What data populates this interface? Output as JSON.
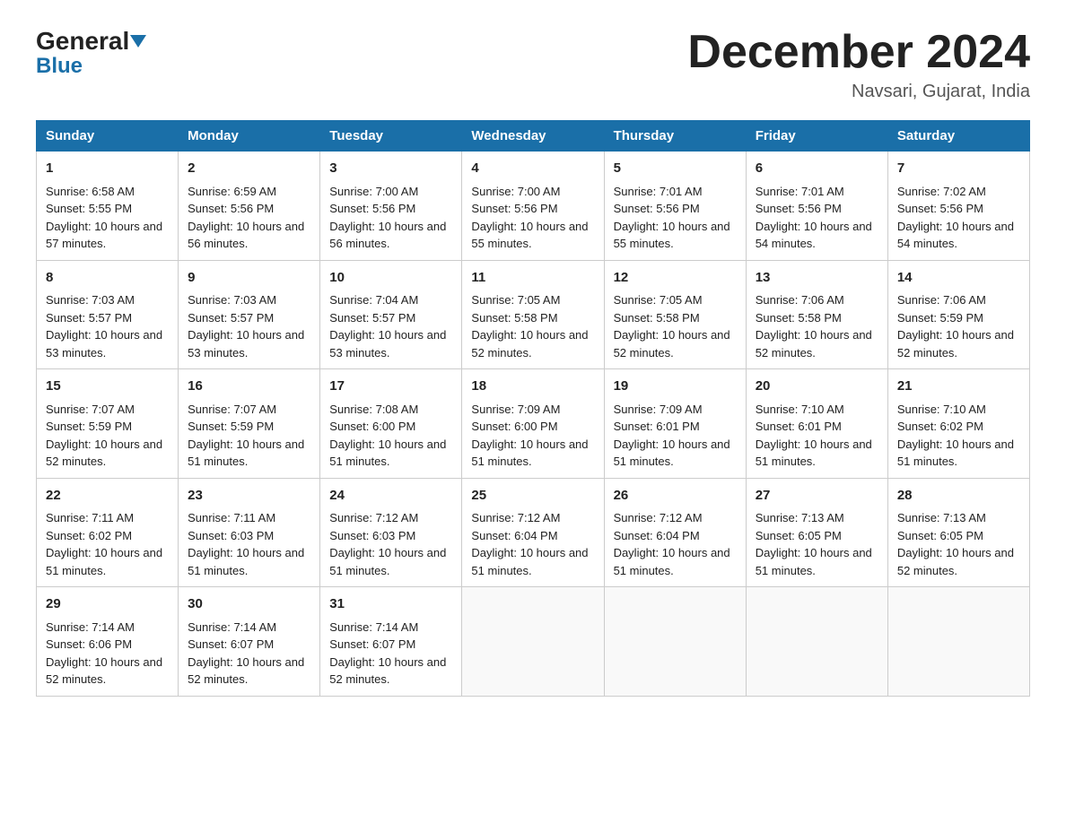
{
  "header": {
    "logo_general": "General",
    "logo_blue": "Blue",
    "month_title": "December 2024",
    "subtitle": "Navsari, Gujarat, India"
  },
  "days_of_week": [
    "Sunday",
    "Monday",
    "Tuesday",
    "Wednesday",
    "Thursday",
    "Friday",
    "Saturday"
  ],
  "weeks": [
    [
      {
        "day": "1",
        "sunrise": "6:58 AM",
        "sunset": "5:55 PM",
        "daylight": "10 hours and 57 minutes."
      },
      {
        "day": "2",
        "sunrise": "6:59 AM",
        "sunset": "5:56 PM",
        "daylight": "10 hours and 56 minutes."
      },
      {
        "day": "3",
        "sunrise": "7:00 AM",
        "sunset": "5:56 PM",
        "daylight": "10 hours and 56 minutes."
      },
      {
        "day": "4",
        "sunrise": "7:00 AM",
        "sunset": "5:56 PM",
        "daylight": "10 hours and 55 minutes."
      },
      {
        "day": "5",
        "sunrise": "7:01 AM",
        "sunset": "5:56 PM",
        "daylight": "10 hours and 55 minutes."
      },
      {
        "day": "6",
        "sunrise": "7:01 AM",
        "sunset": "5:56 PM",
        "daylight": "10 hours and 54 minutes."
      },
      {
        "day": "7",
        "sunrise": "7:02 AM",
        "sunset": "5:56 PM",
        "daylight": "10 hours and 54 minutes."
      }
    ],
    [
      {
        "day": "8",
        "sunrise": "7:03 AM",
        "sunset": "5:57 PM",
        "daylight": "10 hours and 53 minutes."
      },
      {
        "day": "9",
        "sunrise": "7:03 AM",
        "sunset": "5:57 PM",
        "daylight": "10 hours and 53 minutes."
      },
      {
        "day": "10",
        "sunrise": "7:04 AM",
        "sunset": "5:57 PM",
        "daylight": "10 hours and 53 minutes."
      },
      {
        "day": "11",
        "sunrise": "7:05 AM",
        "sunset": "5:58 PM",
        "daylight": "10 hours and 52 minutes."
      },
      {
        "day": "12",
        "sunrise": "7:05 AM",
        "sunset": "5:58 PM",
        "daylight": "10 hours and 52 minutes."
      },
      {
        "day": "13",
        "sunrise": "7:06 AM",
        "sunset": "5:58 PM",
        "daylight": "10 hours and 52 minutes."
      },
      {
        "day": "14",
        "sunrise": "7:06 AM",
        "sunset": "5:59 PM",
        "daylight": "10 hours and 52 minutes."
      }
    ],
    [
      {
        "day": "15",
        "sunrise": "7:07 AM",
        "sunset": "5:59 PM",
        "daylight": "10 hours and 52 minutes."
      },
      {
        "day": "16",
        "sunrise": "7:07 AM",
        "sunset": "5:59 PM",
        "daylight": "10 hours and 51 minutes."
      },
      {
        "day": "17",
        "sunrise": "7:08 AM",
        "sunset": "6:00 PM",
        "daylight": "10 hours and 51 minutes."
      },
      {
        "day": "18",
        "sunrise": "7:09 AM",
        "sunset": "6:00 PM",
        "daylight": "10 hours and 51 minutes."
      },
      {
        "day": "19",
        "sunrise": "7:09 AM",
        "sunset": "6:01 PM",
        "daylight": "10 hours and 51 minutes."
      },
      {
        "day": "20",
        "sunrise": "7:10 AM",
        "sunset": "6:01 PM",
        "daylight": "10 hours and 51 minutes."
      },
      {
        "day": "21",
        "sunrise": "7:10 AM",
        "sunset": "6:02 PM",
        "daylight": "10 hours and 51 minutes."
      }
    ],
    [
      {
        "day": "22",
        "sunrise": "7:11 AM",
        "sunset": "6:02 PM",
        "daylight": "10 hours and 51 minutes."
      },
      {
        "day": "23",
        "sunrise": "7:11 AM",
        "sunset": "6:03 PM",
        "daylight": "10 hours and 51 minutes."
      },
      {
        "day": "24",
        "sunrise": "7:12 AM",
        "sunset": "6:03 PM",
        "daylight": "10 hours and 51 minutes."
      },
      {
        "day": "25",
        "sunrise": "7:12 AM",
        "sunset": "6:04 PM",
        "daylight": "10 hours and 51 minutes."
      },
      {
        "day": "26",
        "sunrise": "7:12 AM",
        "sunset": "6:04 PM",
        "daylight": "10 hours and 51 minutes."
      },
      {
        "day": "27",
        "sunrise": "7:13 AM",
        "sunset": "6:05 PM",
        "daylight": "10 hours and 51 minutes."
      },
      {
        "day": "28",
        "sunrise": "7:13 AM",
        "sunset": "6:05 PM",
        "daylight": "10 hours and 52 minutes."
      }
    ],
    [
      {
        "day": "29",
        "sunrise": "7:14 AM",
        "sunset": "6:06 PM",
        "daylight": "10 hours and 52 minutes."
      },
      {
        "day": "30",
        "sunrise": "7:14 AM",
        "sunset": "6:07 PM",
        "daylight": "10 hours and 52 minutes."
      },
      {
        "day": "31",
        "sunrise": "7:14 AM",
        "sunset": "6:07 PM",
        "daylight": "10 hours and 52 minutes."
      },
      null,
      null,
      null,
      null
    ]
  ],
  "labels": {
    "sunrise": "Sunrise:",
    "sunset": "Sunset:",
    "daylight": "Daylight:"
  }
}
